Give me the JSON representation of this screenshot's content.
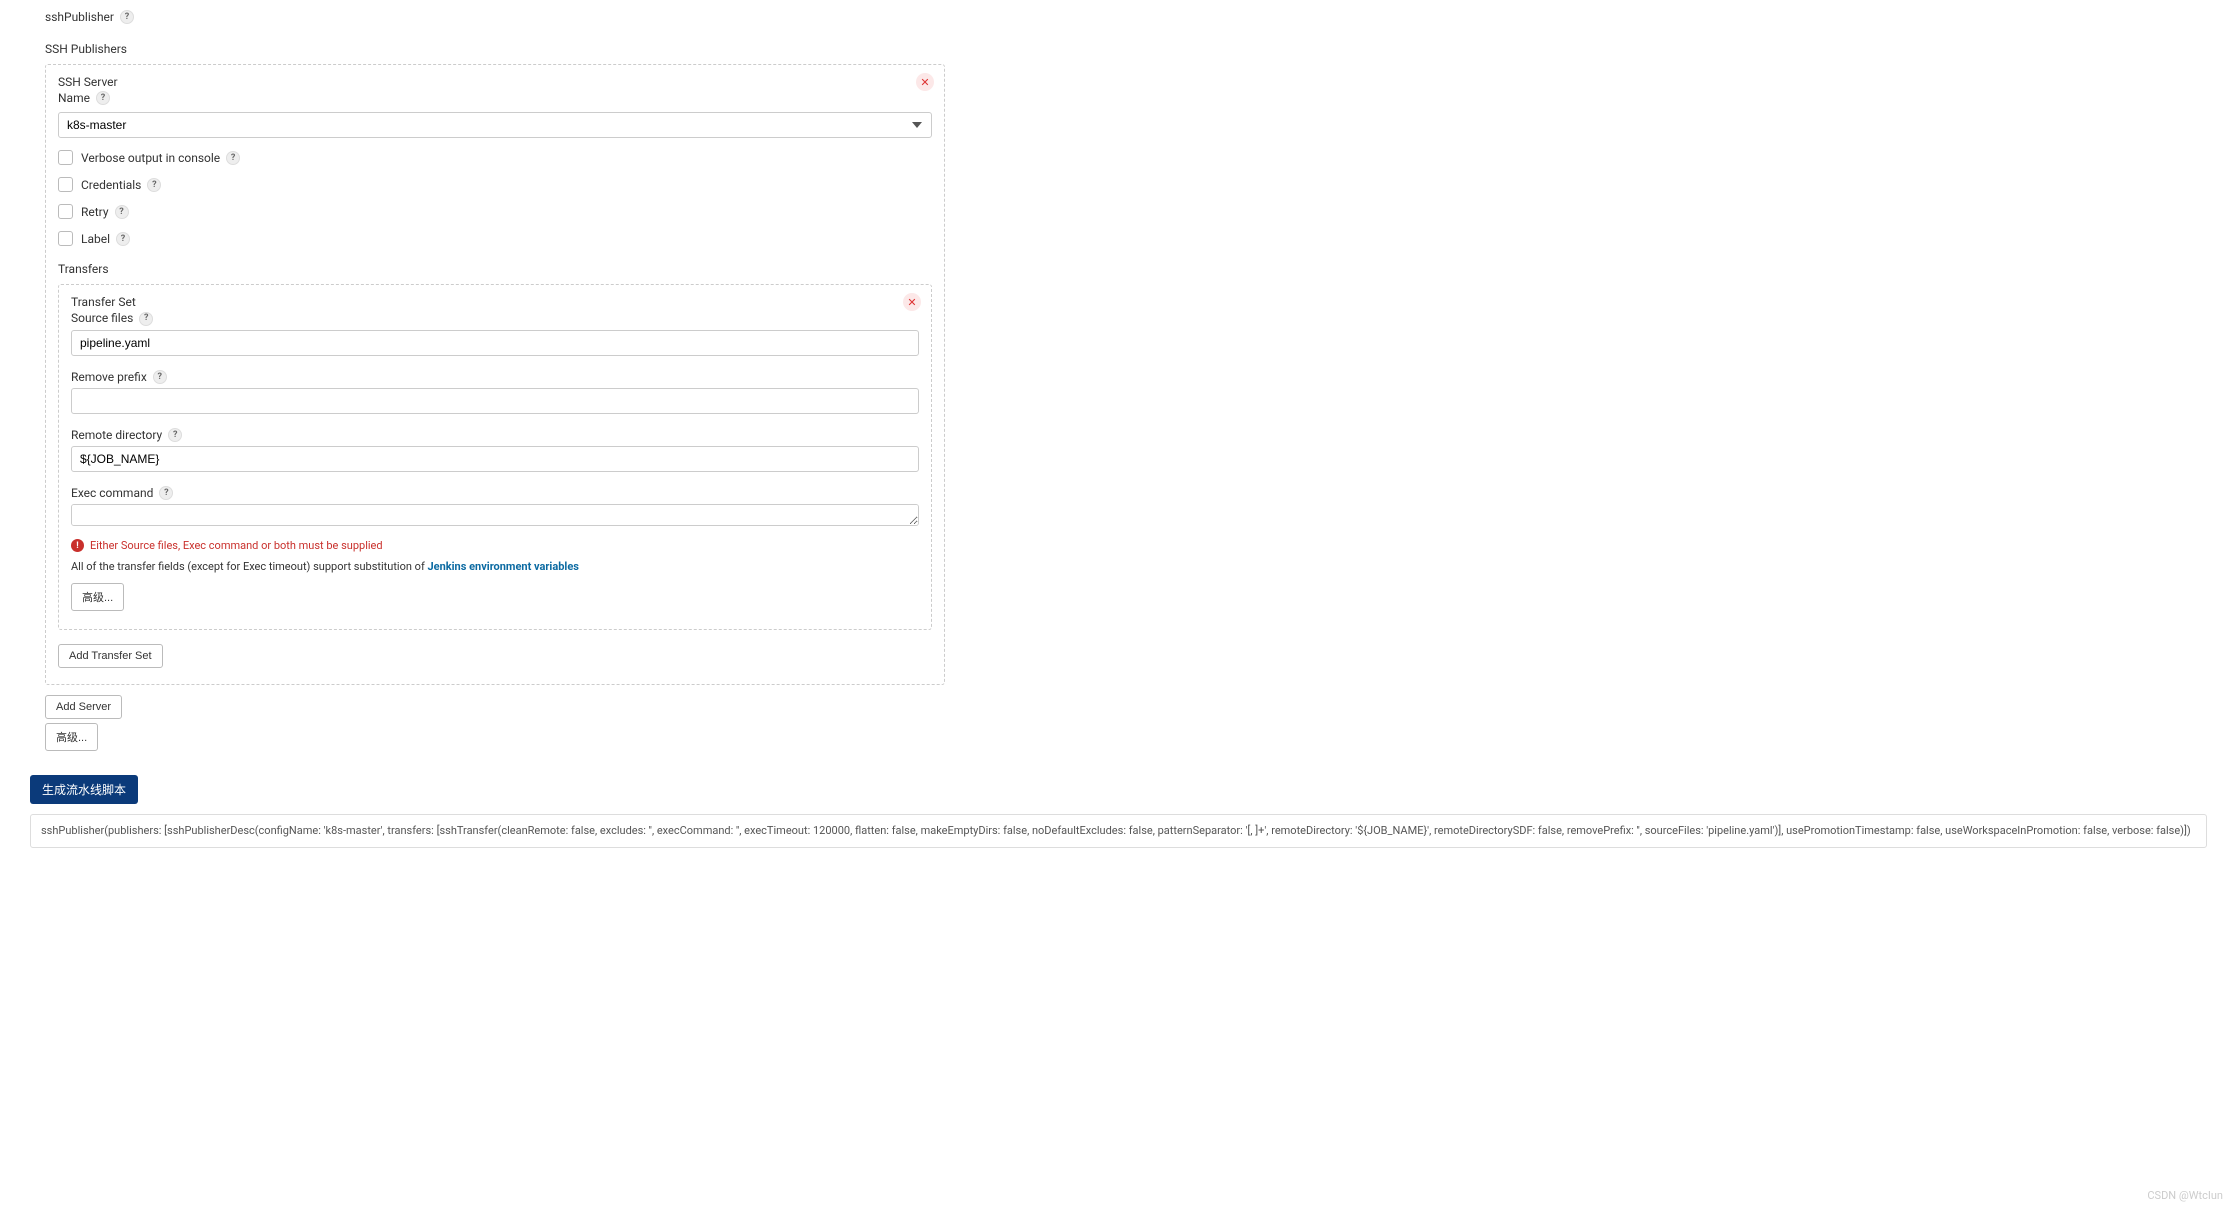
{
  "header": {
    "ssh_publisher_label": "sshPublisher"
  },
  "ssh_publishers_label": "SSH Publishers",
  "ssh_server": {
    "title_line1": "SSH Server",
    "name_label": "Name",
    "selected": "k8s-master"
  },
  "checkboxes": {
    "verbose": "Verbose output in console",
    "credentials": "Credentials",
    "retry": "Retry",
    "label": "Label"
  },
  "transfers": {
    "section_label": "Transfers",
    "transfer_set_label": "Transfer Set",
    "source_files_label": "Source files",
    "source_files_value": "pipeline.yaml",
    "remove_prefix_label": "Remove prefix",
    "remove_prefix_value": "",
    "remote_directory_label": "Remote directory",
    "remote_directory_value": "${JOB_NAME}",
    "exec_command_label": "Exec command",
    "exec_command_value": "",
    "error_message": "Either Source files, Exec command or both must be supplied",
    "hint_prefix": "All of the transfer fields (except for Exec timeout) support substitution of ",
    "hint_link": "Jenkins environment variables",
    "advanced_btn": "高级...",
    "add_transfer_btn": "Add Transfer Set"
  },
  "outer_buttons": {
    "add_server": "Add Server",
    "advanced": "高级..."
  },
  "generate_btn": "生成流水线脚本",
  "pipeline_script": "sshPublisher(publishers: [sshPublisherDesc(configName: 'k8s-master', transfers: [sshTransfer(cleanRemote: false, excludes: '', execCommand: '', execTimeout: 120000, flatten: false, makeEmptyDirs: false, noDefaultExcludes: false, patternSeparator: '[, ]+', remoteDirectory: '${JOB_NAME}', remoteDirectorySDF: false, removePrefix: '', sourceFiles: 'pipeline.yaml')], usePromotionTimestamp: false, useWorkspaceInPromotion: false, verbose: false)])",
  "watermark": "CSDN @WtcIun"
}
